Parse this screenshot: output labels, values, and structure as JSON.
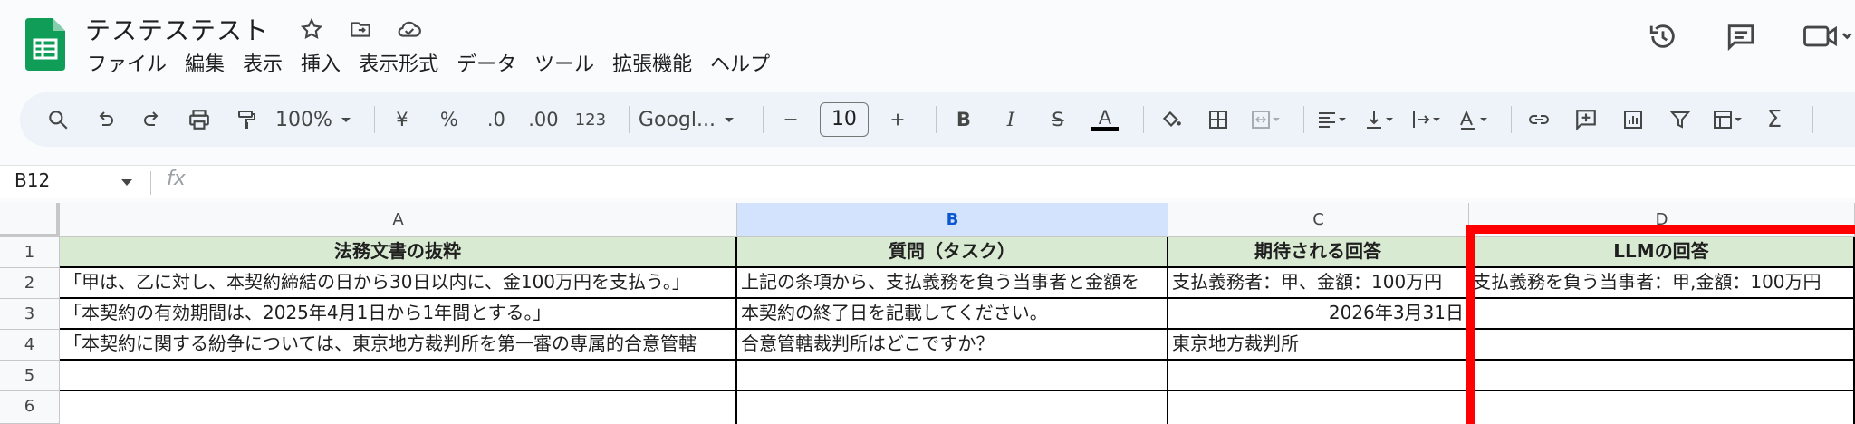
{
  "doc": {
    "title": "テステステスト"
  },
  "menu": [
    "ファイル",
    "編集",
    "表示",
    "挿入",
    "表示形式",
    "データ",
    "ツール",
    "拡張機能",
    "ヘルプ"
  ],
  "toolbar": {
    "zoom": "100%",
    "percent": "%",
    "decimal_dec": ".0",
    "decimal_inc": ".00",
    "number_format": "123",
    "currency": "¥",
    "font": "Googl...",
    "font_size": "10",
    "bold": "B",
    "italic": "I",
    "strike": "S",
    "text_color": "A"
  },
  "formula": {
    "name_box": "B12",
    "fx": "fx"
  },
  "columns": [
    "A",
    "B",
    "C",
    "D"
  ],
  "rows": [
    "1",
    "2",
    "3",
    "4",
    "5",
    "6"
  ],
  "cells": {
    "r1": {
      "a": "法務文書の抜粋",
      "b": "質問（タスク）",
      "c": "期待される回答",
      "d": "LLMの回答"
    },
    "r2": {
      "a": "「甲は、乙に対し、本契約締結の日から30日以内に、金100万円を支払う。」",
      "b": "上記の条項から、支払義務を負う当事者と金額を",
      "c": "支払義務者：甲、金額：100万円",
      "d": "支払義務を負う当事者：甲,金額：100万円"
    },
    "r3": {
      "a": "「本契約の有効期間は、2025年4月1日から1年間とする。」",
      "b": "本契約の終了日を記載してください。",
      "c": "2026年3月31日",
      "d": ""
    },
    "r4": {
      "a": "「本契約に関する紛争については、東京地方裁判所を第一審の専属的合意管轄",
      "b": "合意管轄裁判所はどこですか？",
      "c": "東京地方裁判所",
      "d": ""
    }
  },
  "colors": {
    "accent": "#0b57d0",
    "header_fill": "#d9ead3",
    "highlight": "#ff0000",
    "sheets_green": "#0f9d58"
  }
}
